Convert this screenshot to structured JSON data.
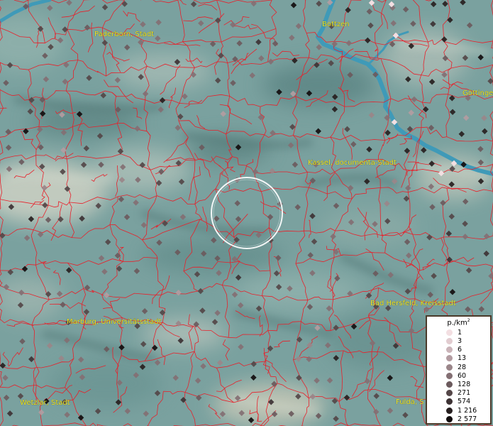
{
  "map": {
    "cities": [
      {
        "name": "Paderborn, Stadt"
      },
      {
        "name": "Bottzen"
      },
      {
        "name": "Göttingen"
      },
      {
        "name": "Kassel, documenta-Stadt"
      },
      {
        "name": "Bad Hersfeld, Kreisstadt"
      },
      {
        "name": "Marburg, Universitätsstadt"
      },
      {
        "name": "Wetzlar, Stadt"
      },
      {
        "name": "Fulda, S"
      }
    ],
    "colors": {
      "terrain": "#7fa3a1",
      "river": "#3f9ab8",
      "borders": "#e8202a",
      "label_text": "#f0e428",
      "selection_ring": "#ffffff"
    }
  },
  "legend": {
    "title": "p./km",
    "title_superscript": "2",
    "items": [
      {
        "label": "1",
        "color": "#f3dfe2"
      },
      {
        "label": "3",
        "color": "#e2ccd0"
      },
      {
        "label": "6",
        "color": "#cbb4b9"
      },
      {
        "label": "13",
        "color": "#b39ca1"
      },
      {
        "label": "28",
        "color": "#9a8589"
      },
      {
        "label": "60",
        "color": "#836f73"
      },
      {
        "label": "128",
        "color": "#6b5a5d"
      },
      {
        "label": "271",
        "color": "#544648"
      },
      {
        "label": "574",
        "color": "#3d3234"
      },
      {
        "label": "1 216",
        "color": "#271f20"
      },
      {
        "label": "2 577",
        "color": "#120d0e"
      }
    ]
  }
}
